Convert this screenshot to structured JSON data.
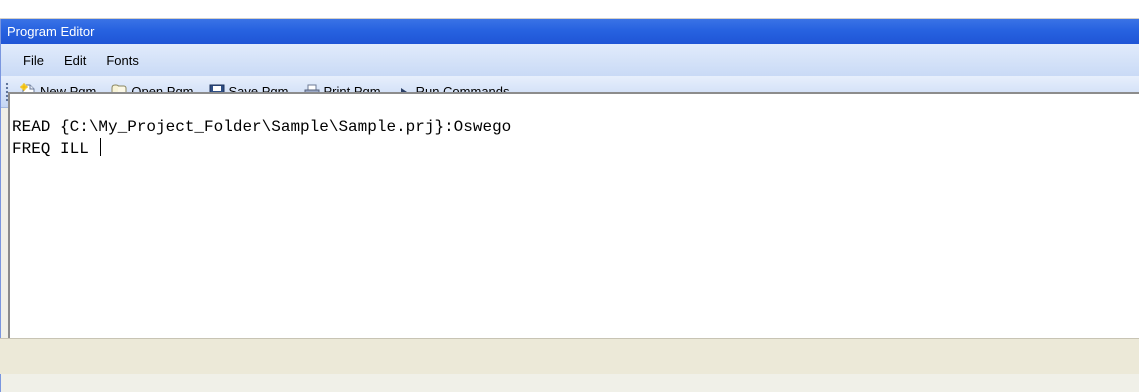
{
  "window": {
    "title": "Program Editor"
  },
  "menu": {
    "items": [
      {
        "label": "File"
      },
      {
        "label": "Edit"
      },
      {
        "label": "Fonts"
      }
    ]
  },
  "toolbar": {
    "new_label": "New Pgm",
    "open_label": "Open Pgm",
    "save_label": "Save Pgm",
    "print_label": "Print Pgm",
    "run_label": "Run Commands"
  },
  "editor": {
    "lines": [
      "READ {C:\\My_Project_Folder\\Sample\\Sample.prj}:Oswego",
      "FREQ ILL "
    ]
  },
  "icons": {
    "new": "new-file-icon",
    "open": "open-folder-icon",
    "save": "floppy-disk-icon",
    "print": "printer-icon",
    "run": "play-arrow-icon"
  }
}
